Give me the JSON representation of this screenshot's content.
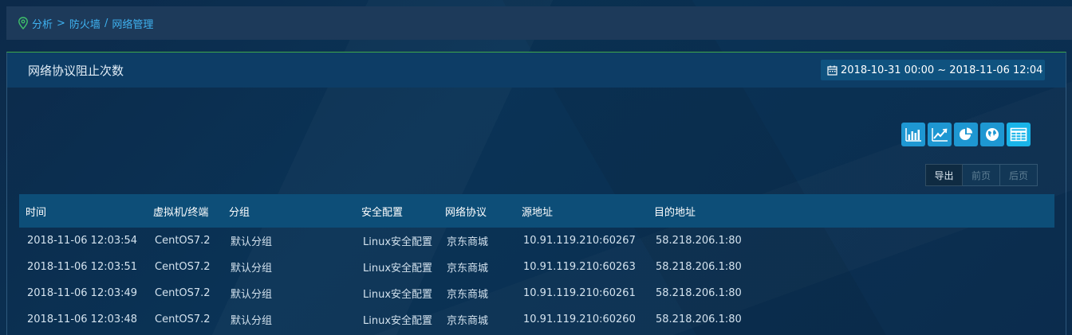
{
  "breadcrumb": {
    "items": [
      "分析",
      "防火墙",
      "网络管理"
    ],
    "separators": [
      ">",
      "/"
    ]
  },
  "panel": {
    "title": "网络协议阻止次数",
    "date_range": "2018-10-31 00:00 ~ 2018-11-06 12:04"
  },
  "chart_toggles": [
    {
      "icon": "bar-chart-icon"
    },
    {
      "icon": "line-chart-icon"
    },
    {
      "icon": "pie-chart-icon"
    },
    {
      "icon": "globe-icon"
    },
    {
      "icon": "table-icon",
      "active": true
    }
  ],
  "pager": {
    "export_label": "导出",
    "prev_label": "前页",
    "next_label": "后页"
  },
  "table": {
    "columns": [
      "时间",
      "虚拟机/终端",
      "分组",
      "安全配置",
      "网络协议",
      "源地址",
      "目的地址"
    ],
    "rows": [
      [
        "2018-11-06 12:03:54",
        "CentOS7.2",
        "默认分组",
        "Linux安全配置",
        "京东商城",
        "10.91.119.210:60267",
        "58.218.206.1:80"
      ],
      [
        "2018-11-06 12:03:51",
        "CentOS7.2",
        "默认分组",
        "Linux安全配置",
        "京东商城",
        "10.91.119.210:60263",
        "58.218.206.1:80"
      ],
      [
        "2018-11-06 12:03:49",
        "CentOS7.2",
        "默认分组",
        "Linux安全配置",
        "京东商城",
        "10.91.119.210:60261",
        "58.218.206.1:80"
      ],
      [
        "2018-11-06 12:03:48",
        "CentOS7.2",
        "默认分组",
        "Linux安全配置",
        "京东商城",
        "10.91.119.210:60260",
        "58.218.206.1:80"
      ]
    ]
  },
  "colors": {
    "accent": "#3fb2f0",
    "header_bg": "#0d4e78",
    "panel_head_bg": "#0d3d66",
    "button_blue": "#1e97d2",
    "border_green": "#3fa84a"
  }
}
